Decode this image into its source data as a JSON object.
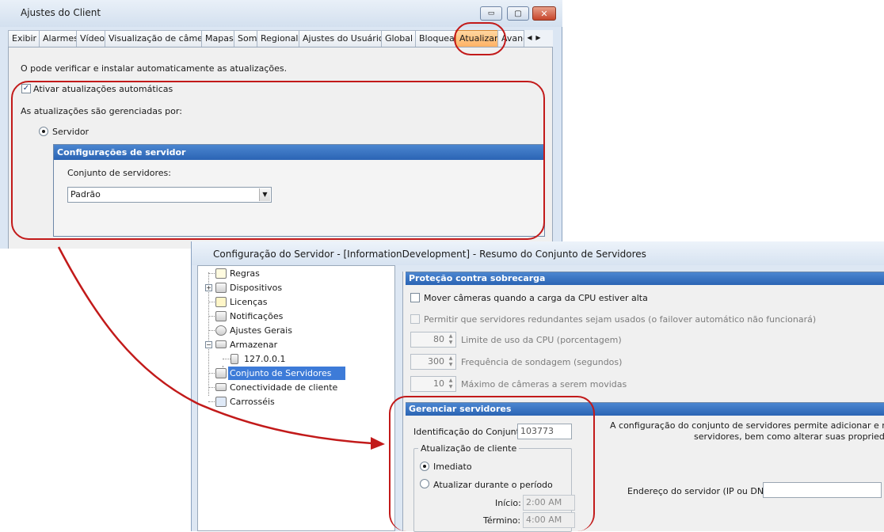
{
  "window1": {
    "title": "Ajustes do  Client",
    "caption_minimize": "▭",
    "caption_maximize": "▢",
    "caption_close": "✕",
    "tabs": [
      "Exibir",
      "Alarmes",
      "Vídeo",
      "Visualização de câmera",
      "Mapas",
      "Som",
      "Regional",
      "Ajustes do Usuário",
      "Global",
      "Bloquear",
      "Atualizar",
      "Avanç"
    ],
    "active_tab": "Atualizar",
    "tab_arrow_left": "◀",
    "tab_arrow_right": "▶",
    "intro_text": "O pode verificar e instalar automaticamente as atualizações.",
    "auto_update_label": "Ativar atualizações automáticas",
    "auto_update_checked": true,
    "managed_by_label": "As atualizações são gerenciadas por:",
    "server_option_label": "Servidor",
    "server_config": {
      "header": "Configurações de servidor",
      "pool_label": "Conjunto de servidores:",
      "pool_value": "Padrão"
    }
  },
  "window2": {
    "title": "Configuração do Servidor - [InformationDevelopment] - Resumo do Conjunto de Servidores",
    "tree": [
      {
        "label": "Regras",
        "icon": "rules-icon",
        "expander": false
      },
      {
        "label": "Dispositivos",
        "icon": "devices-icon",
        "expander": true
      },
      {
        "label": "Licenças",
        "icon": "licenses-icon",
        "expander": false
      },
      {
        "label": "Notificações",
        "icon": "notifications-icon",
        "expander": false
      },
      {
        "label": "Ajustes Gerais",
        "icon": "general-settings-icon",
        "expander": false
      },
      {
        "label": "Armazenar",
        "icon": "storage-icon",
        "expander": true
      },
      {
        "label": "127.0.0.1",
        "icon": "server-icon",
        "expander": false
      },
      {
        "label": "Conjunto de Servidores",
        "icon": "server-pool-icon",
        "expander": false
      },
      {
        "label": "Conectividade de cliente",
        "icon": "client-connectivity-icon",
        "expander": false
      },
      {
        "label": "Carrosséis",
        "icon": "carousel-icon",
        "expander": false
      }
    ],
    "selected_tree_item": "Conjunto de Servidores",
    "overload": {
      "header": "Proteção contra sobrecarga",
      "move_cameras_label": "Mover câmeras quando a carga da CPU estiver alta",
      "redundant_label": "Permitir que servidores redundantes sejam usados (o failover automático não funcionará)",
      "cpu_value": "80",
      "cpu_label": "Limite de uso da CPU (porcentagem)",
      "poll_value": "300",
      "poll_label": "Frequência de sondagem (segundos)",
      "max_value": "10",
      "max_label": "Máximo de câmeras a serem movidas"
    },
    "manage": {
      "header": "Gerenciar servidores",
      "pool_id_label": "Identificação do Conjunto",
      "pool_id_value": "103773",
      "description_line1": "A configuração do conjunto de servidores permite adicionar e remover",
      "description_line2": "servidores, bem como alterar suas propriedades.",
      "client_update_legend": "Atualização de cliente",
      "immediate_label": "Imediato",
      "during_period_label": "Atualizar durante o período",
      "start_label": "Início:",
      "start_value": "2:00 AM",
      "end_label": "Término:",
      "end_value": "4:00 AM",
      "server_address_label": "Endereço do servidor (IP ou DNS)",
      "server_address_value": ""
    }
  },
  "colors": {
    "accent_blue": "#2b64b4",
    "annotation_red": "#c21a1a",
    "active_tab": "#ffb264"
  }
}
